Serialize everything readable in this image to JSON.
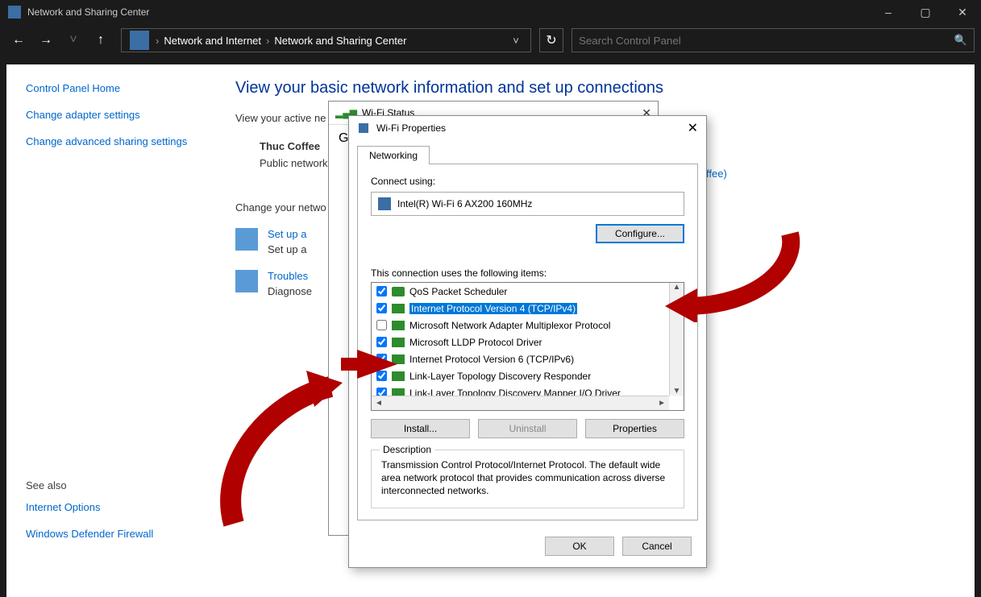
{
  "window": {
    "title": "Network and Sharing Center",
    "minimize": "–",
    "maximize": "▢",
    "close": "✕"
  },
  "nav": {
    "back": "←",
    "forward": "→",
    "recent": "˅",
    "up": "↑",
    "refresh": "↻",
    "dropdown": "˅"
  },
  "breadcrumb": {
    "c1": "Network and Internet",
    "c2": "Network and Sharing Center"
  },
  "search": {
    "placeholder": "Search Control Panel"
  },
  "sidebar": {
    "home": "Control Panel Home",
    "adapter": "Change adapter settings",
    "advanced": "Change advanced sharing settings",
    "seealso": "See also",
    "inet": "Internet Options",
    "firewall": "Windows Defender Firewall"
  },
  "main": {
    "heading": "View your basic network information and set up connections",
    "activeprefix": "View your active ne",
    "netname": "Thuc Coffee",
    "nettype": "Public network",
    "ffee": "ffee)",
    "changehdr": "Change your netwo",
    "setup_title": "Set up a",
    "setup_desc": "Set up a",
    "trouble_title": "Troubles",
    "trouble_desc": "Diagnose"
  },
  "wifi_status": {
    "title": "Wi-Fi Status",
    "general": "G"
  },
  "wifi_props": {
    "title": "Wi-Fi Properties",
    "tab": "Networking",
    "connect_using": "Connect using:",
    "adapter": "Intel(R) Wi-Fi 6 AX200 160MHz",
    "configure": "Configure...",
    "items_label": "This connection uses the following items:",
    "items": [
      {
        "label": "QoS Packet Scheduler",
        "checked": true,
        "icon": "sched"
      },
      {
        "label": "Internet Protocol Version 4 (TCP/IPv4)",
        "checked": true,
        "selected": true,
        "icon": "net"
      },
      {
        "label": "Microsoft Network Adapter Multiplexor Protocol",
        "checked": false,
        "icon": "net"
      },
      {
        "label": "Microsoft LLDP Protocol Driver",
        "checked": true,
        "icon": "net"
      },
      {
        "label": "Internet Protocol Version 6 (TCP/IPv6)",
        "checked": true,
        "icon": "net"
      },
      {
        "label": "Link-Layer Topology Discovery Responder",
        "checked": true,
        "icon": "net"
      },
      {
        "label": "Link-Layer Topology Discovery Mapper I/O Driver",
        "checked": true,
        "icon": "net"
      }
    ],
    "install": "Install...",
    "uninstall": "Uninstall",
    "properties": "Properties",
    "desc_legend": "Description",
    "desc_text": "Transmission Control Protocol/Internet Protocol. The default wide area network protocol that provides communication across diverse interconnected networks.",
    "ok": "OK",
    "cancel": "Cancel"
  }
}
